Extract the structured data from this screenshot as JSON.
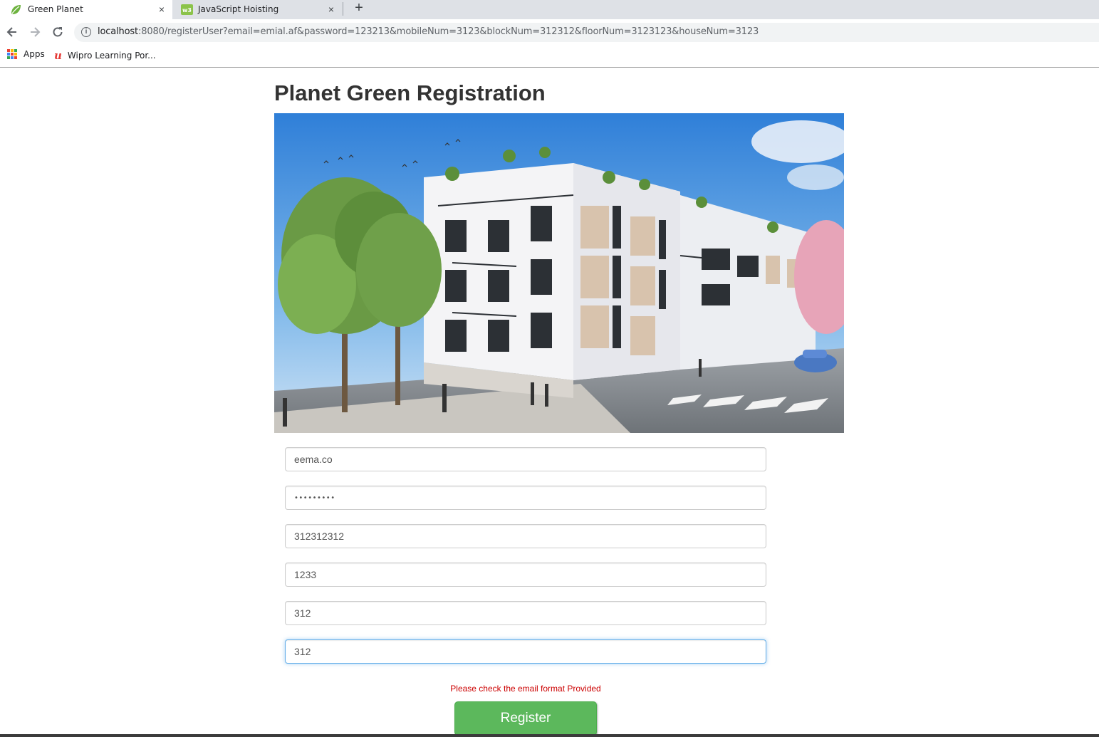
{
  "browser": {
    "tabs": [
      {
        "title": "Green Planet",
        "active": true,
        "icon": "spring-leaf-icon"
      },
      {
        "title": "JavaScript Hoisting",
        "active": false,
        "icon": "w3schools-icon"
      }
    ],
    "new_tab_label": "+",
    "close_label": "×",
    "url_host": "localhost",
    "url_rest": ":8080/registerUser?email=emial.af&password=123213&mobileNum=3123&blockNum=312312&floorNum=3123123&houseNum=3123",
    "bookmarks": [
      {
        "label": "Apps",
        "icon": "apps-grid-icon"
      },
      {
        "label": "Wipro Learning Por...",
        "icon": "wipro-u-icon"
      }
    ]
  },
  "page": {
    "title": "Planet Green Registration",
    "hero_image": "apartment-building-illustration",
    "fields": {
      "email": "eema.co",
      "password": "•••••••••",
      "mobile": "312312312",
      "block": "1233",
      "floor": "312",
      "house": "312"
    },
    "error_message": "Please check the email format Provided",
    "register_label": "Register"
  },
  "colors": {
    "accent_green": "#5cb85c",
    "error_red": "#cc0000",
    "focus_blue": "#66afe9"
  }
}
